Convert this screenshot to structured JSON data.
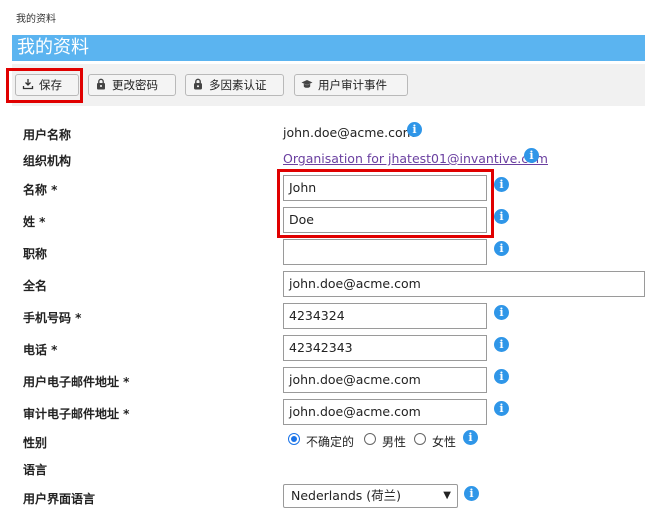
{
  "breadcrumb": "我的资料",
  "page_title": "我的资料",
  "toolbar": {
    "save": "保存",
    "change_password": "更改密码",
    "mfa": "多因素认证",
    "audit_events": "用户审计事件"
  },
  "form": {
    "username_label": "用户名称",
    "username_value": "john.doe@acme.com",
    "organisation_label": "组织机构",
    "organisation_value": "Organisation for jhatest01@invantive.com",
    "first_name_label": "名称 *",
    "first_name_value": "John",
    "last_name_label": "姓 *",
    "last_name_value": "Doe",
    "job_title_label": "职称",
    "job_title_value": "",
    "full_name_label": "全名",
    "full_name_value": "john.doe@acme.com",
    "mobile_label": "手机号码 *",
    "mobile_value": "4234324",
    "phone_label": "电话 *",
    "phone_value": "42342343",
    "user_email_label": "用户电子邮件地址 *",
    "user_email_value": "john.doe@acme.com",
    "audit_email_label": "审计电子邮件地址 *",
    "audit_email_value": "john.doe@acme.com",
    "gender_label": "性别",
    "gender_options": [
      "不确定的",
      "男性",
      "女性"
    ],
    "gender_selected": "不确定的",
    "language_label": "语言",
    "ui_language_label": "用户界面语言",
    "ui_language_value": "Nederlands (荷兰)"
  },
  "info_icon_glyph": "i",
  "colors": {
    "title_bar": "#5bb4f0",
    "info_icon": "#2f96e8",
    "highlight": "#e00000",
    "link": "#6a3fa0"
  }
}
